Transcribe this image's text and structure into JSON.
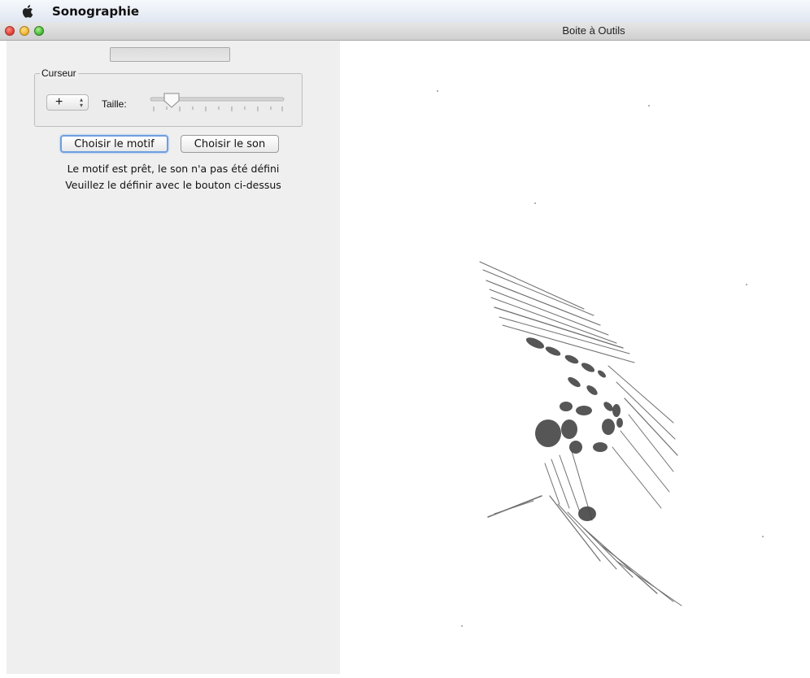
{
  "menubar": {
    "app_name": "Sonographie",
    "apple_icon": "apple-icon"
  },
  "window": {
    "title": "Boite à Outils"
  },
  "tools": {
    "progress_value": "",
    "cursor_group": {
      "label": "Curseur",
      "stepper_value": "+",
      "size_label": "Taille:"
    },
    "choose_pattern_label": "Choisir le motif",
    "choose_sound_label": "Choisir le son",
    "status_line1": "Le motif est prêt, le son n'a pas été défini",
    "status_line2": "Veuillez le définir avec le bouton ci-dessus"
  },
  "canvas": {
    "content": "sonogram-image"
  },
  "colors": {
    "focus_ring": "#6e9fe0",
    "panel_bg": "#efefef"
  }
}
